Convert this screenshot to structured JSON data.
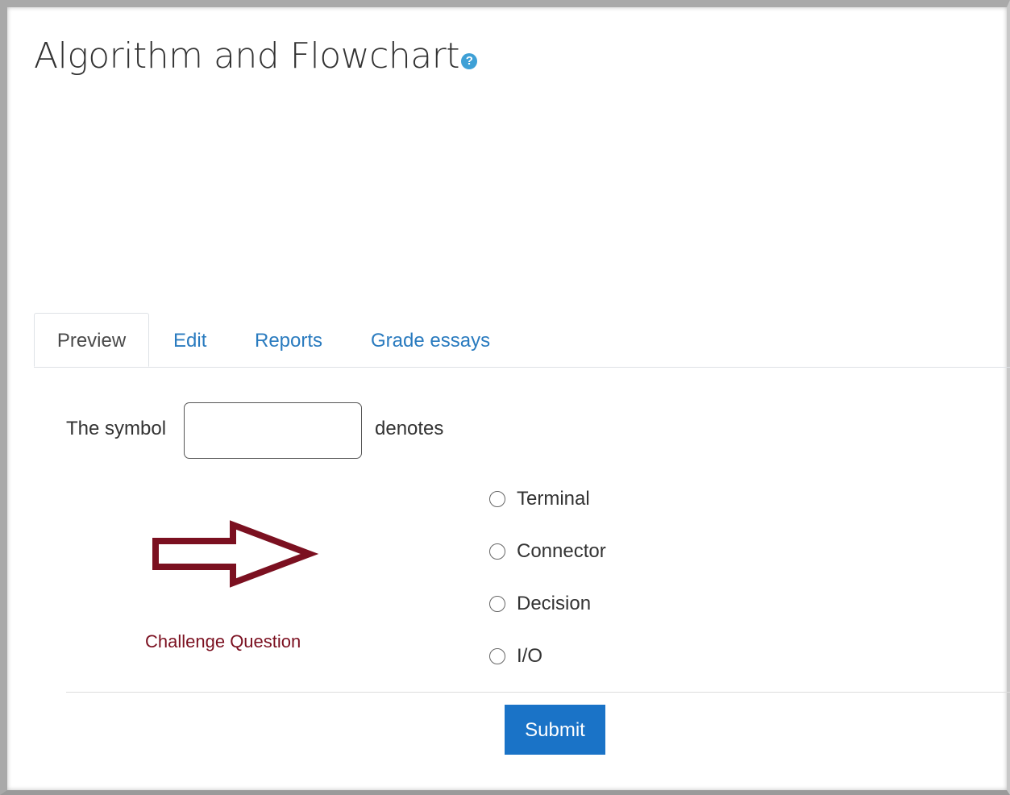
{
  "page": {
    "title": "Algorithm and Flowchart",
    "help_icon": "question-circle-icon"
  },
  "tabs": [
    {
      "label": "Preview",
      "active": true
    },
    {
      "label": "Edit",
      "active": false
    },
    {
      "label": "Reports",
      "active": false
    },
    {
      "label": "Grade essays",
      "active": false
    }
  ],
  "question": {
    "prefix": "The symbol",
    "suffix": "denotes",
    "answer_value": "",
    "options": [
      {
        "label": "Terminal",
        "selected": false
      },
      {
        "label": "Connector",
        "selected": false
      },
      {
        "label": "Decision",
        "selected": false
      },
      {
        "label": "I/O",
        "selected": false
      }
    ]
  },
  "annotation": {
    "label": "Challenge Question",
    "icon": "right-arrow-icon",
    "color": "#7b1020"
  },
  "actions": {
    "submit_label": "Submit"
  },
  "colors": {
    "link": "#2a7bbf",
    "primary_button": "#1a73c7",
    "help_icon": "#3ea0d6"
  }
}
